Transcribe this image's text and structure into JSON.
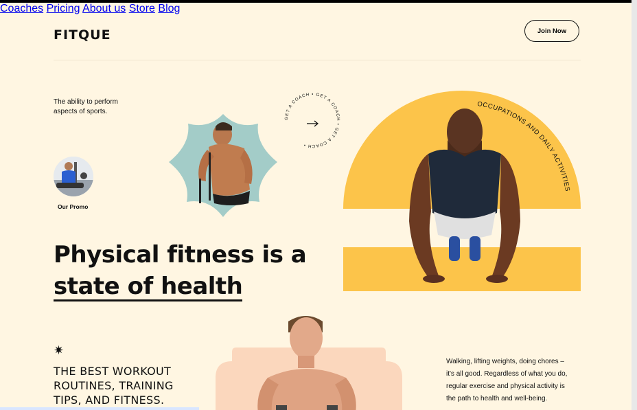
{
  "brand": {
    "logo": "FITQUE"
  },
  "nav": {
    "items": [
      "Coaches",
      "Pricing",
      "About us",
      "Store",
      "Blog"
    ]
  },
  "header": {
    "join_label": "Join Now"
  },
  "intro": {
    "ability_text": "The ability to perform aspects of sports.",
    "promo_label": "Our Promo"
  },
  "badge": {
    "circular_text": "GET A COACH • GET A COACH • GET A COACH • "
  },
  "hero": {
    "arc_text": "OCCUPATIONS AND DAILY ACTIVITIES",
    "headline_line1": "Physical fitness is a",
    "headline_line2": "state of health",
    "accent_color": "#fcc44a",
    "mint_color": "#a3ccc8",
    "peach_color": "#fbd7bd"
  },
  "section2": {
    "workout_line1": "THE BEST WORKOUT",
    "workout_line2": "ROUTINES, TRAINING",
    "workout_line3": "TIPS, AND FITNESS.",
    "paragraph_line1": "Walking, lifting weights, doing chores –",
    "paragraph_line2": "it's all good. Regardless of what you do,",
    "paragraph_line3": "regular exercise and physical activity is",
    "paragraph_line4": "the path to health and well-being."
  }
}
